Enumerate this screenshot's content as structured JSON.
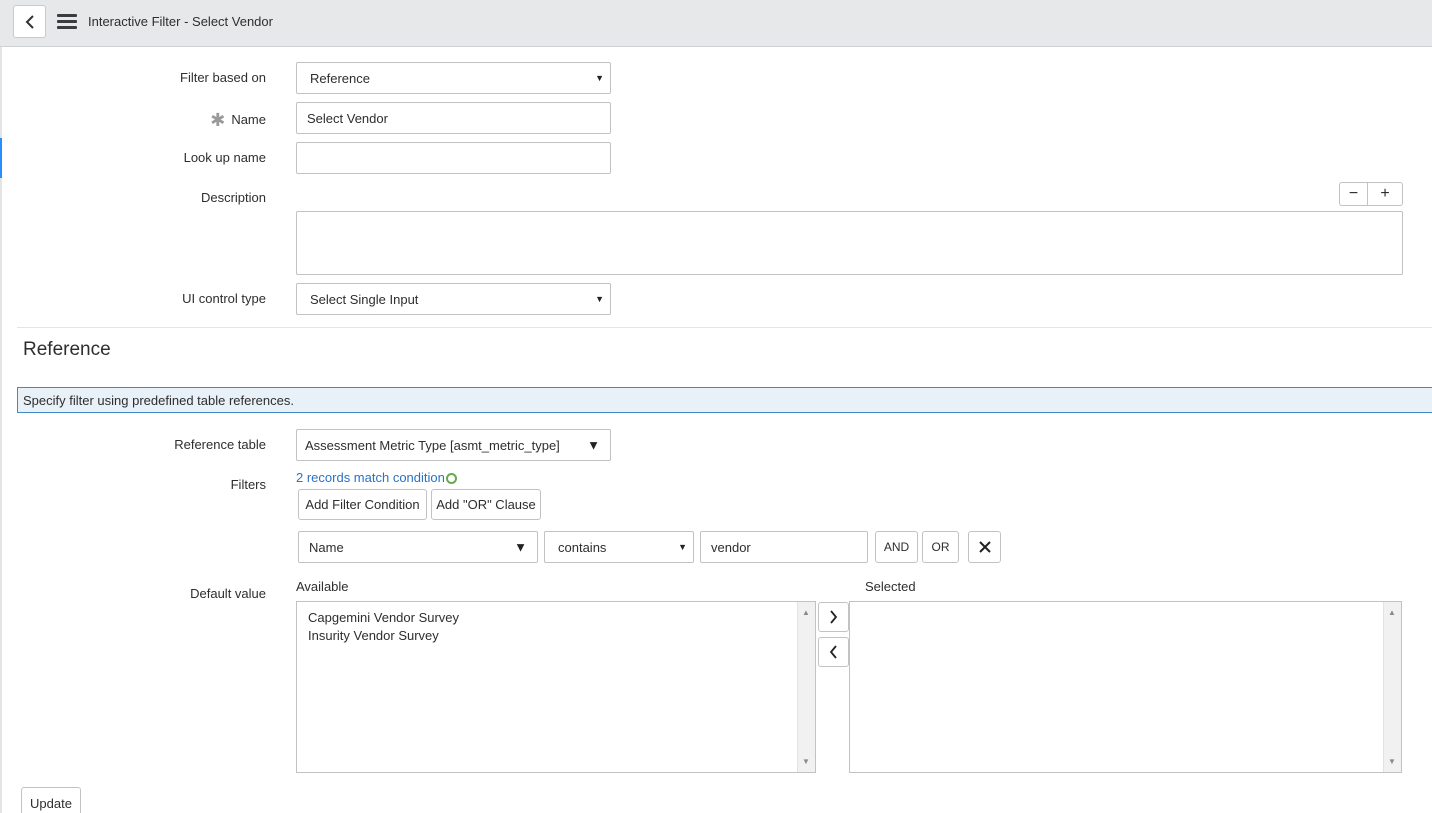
{
  "header": {
    "title": "Interactive Filter - Select Vendor",
    "back_icon": "chevron-left-icon",
    "menu_icon": "hamburger-menu-icon"
  },
  "form": {
    "filter_based_on": {
      "label": "Filter based on",
      "value": "Reference"
    },
    "name": {
      "label": "Name",
      "value": "Select Vendor",
      "required_mark": "✱"
    },
    "lookup_name": {
      "label": "Look up name",
      "value": ""
    },
    "description": {
      "label": "Description",
      "value": "",
      "shrink_label": "−",
      "expand_label": "+"
    },
    "ui_control_type": {
      "label": "UI control type",
      "value": "Select Single Input"
    }
  },
  "reference_section": {
    "title": "Reference",
    "info": "Specify filter using predefined table references.",
    "reference_table": {
      "label": "Reference table",
      "value": "Assessment Metric Type [asmt_metric_type]"
    },
    "filters": {
      "label": "Filters",
      "match_link": "2 records match condition",
      "add_condition": "Add Filter Condition",
      "add_or": "Add \"OR\" Clause",
      "condition": {
        "field": "Name",
        "operator": "contains",
        "value": "vendor",
        "and_label": "AND",
        "or_label": "OR",
        "remove_icon": "close-icon"
      }
    },
    "default_value": {
      "label": "Default value",
      "available_label": "Available",
      "selected_label": "Selected",
      "available": [
        "Capgemini Vendor Survey",
        "Insurity Vendor Survey"
      ],
      "selected": [],
      "move_right_icon": "chevron-right-icon",
      "move_left_icon": "chevron-left-icon"
    }
  },
  "footer": {
    "update_label": "Update"
  },
  "colors": {
    "accent": "#278efc",
    "link": "#2a72c4",
    "info_border": "#3f8ac7",
    "info_bg": "#e8f0f8"
  }
}
